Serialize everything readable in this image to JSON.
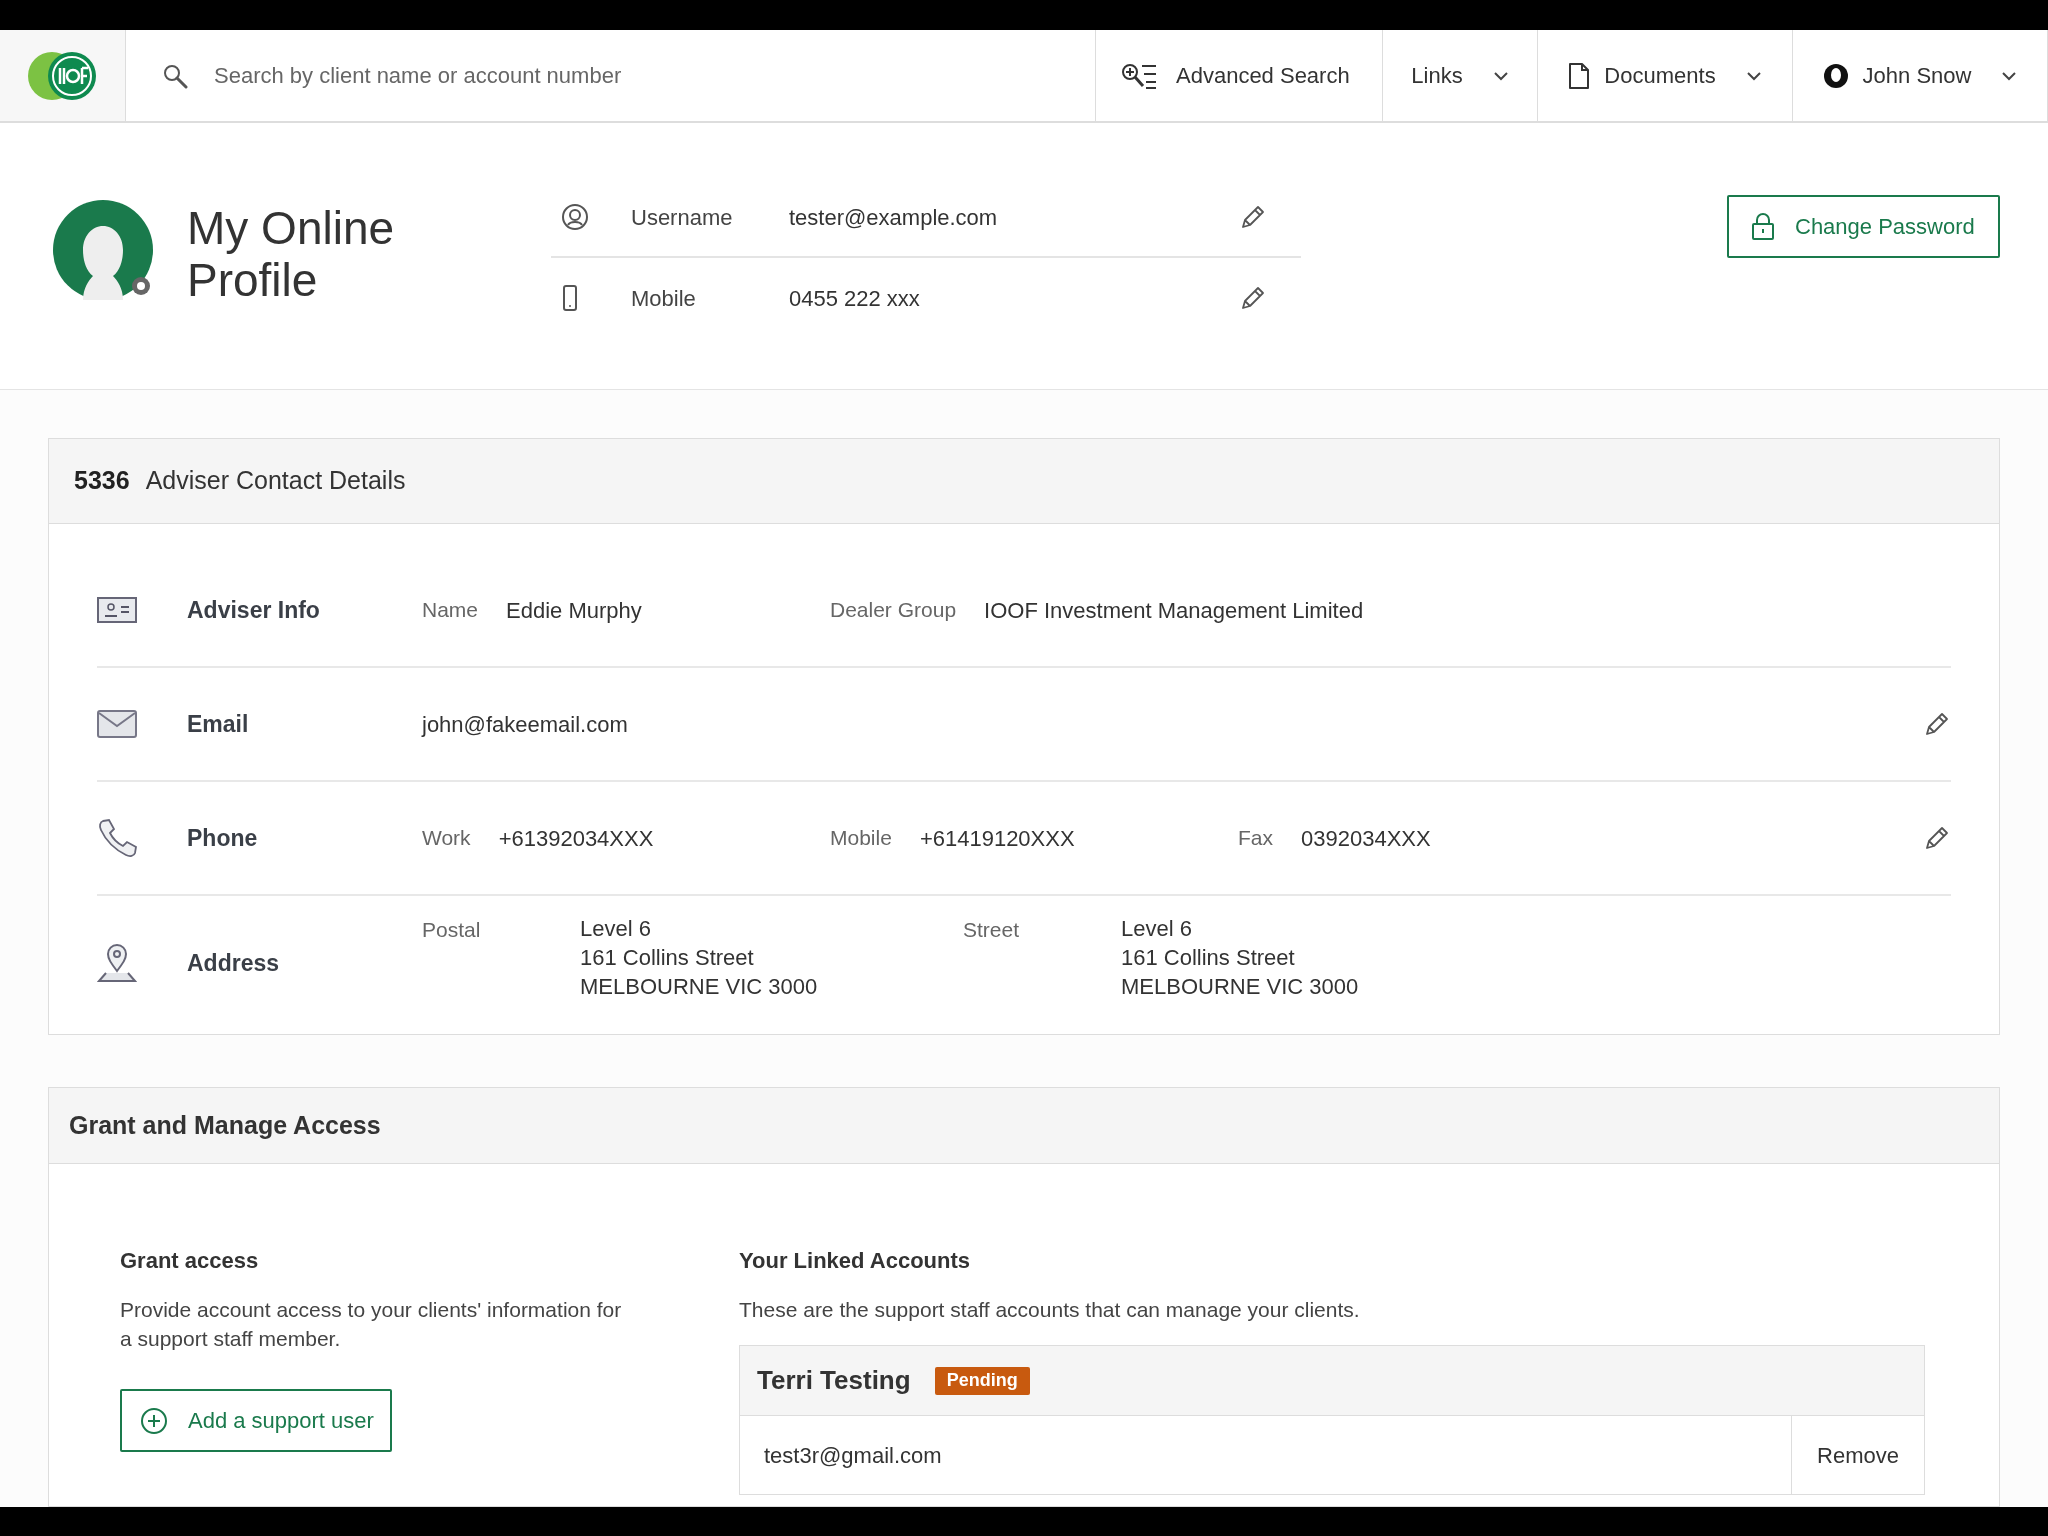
{
  "nav": {
    "search": {
      "placeholder": "Search by client name or account number"
    },
    "advanced_search": "Advanced Search",
    "menus": [
      {
        "kind": "links",
        "label": "Links"
      },
      {
        "kind": "documents",
        "label": "Documents"
      },
      {
        "kind": "user",
        "label": "John Snow"
      }
    ]
  },
  "profile": {
    "title": "My Online Profile",
    "fields": [
      {
        "kind": "username",
        "label": "Username",
        "value": "tester@example.com"
      },
      {
        "kind": "mobile",
        "label": "Mobile",
        "value": "0455 222 xxx"
      }
    ],
    "change_password": "Change Password"
  },
  "adviser_contact": {
    "number": "5336",
    "title": "Adviser Contact Details",
    "rows": [
      {
        "kind": "info",
        "label": "Adviser Info",
        "editable": false,
        "pairs": [
          {
            "label": "Name",
            "value": "Eddie Murphy"
          },
          {
            "label": "Dealer Group",
            "value": "IOOF Investment Management Limited"
          }
        ]
      },
      {
        "kind": "email",
        "label": "Email",
        "editable": true,
        "value": "john@fakeemail.com"
      },
      {
        "kind": "phone",
        "label": "Phone",
        "editable": true,
        "pairs": [
          {
            "label": "Work",
            "value": "+61392034XXX"
          },
          {
            "label": "Mobile",
            "value": "+61419120XXX"
          },
          {
            "label": "Fax",
            "value": "0392034XXX"
          }
        ]
      },
      {
        "kind": "address",
        "label": "Address",
        "editable": false,
        "addresses": [
          {
            "label": "Postal",
            "lines": [
              "Level 6",
              "161 Collins Street",
              "MELBOURNE VIC 3000"
            ]
          },
          {
            "label": "Street",
            "lines": [
              "Level 6",
              "161 Collins Street",
              "MELBOURNE VIC 3000"
            ]
          }
        ]
      }
    ]
  },
  "access": {
    "title": "Grant and Manage Access",
    "grant": {
      "heading": "Grant access",
      "text": "Provide account access to your clients' information for a support staff member.",
      "button": "Add a support user"
    },
    "linked": {
      "heading": "Your Linked Accounts",
      "text": "These are the support staff accounts that can manage your clients.",
      "accounts": [
        {
          "name": "Terri Testing",
          "status": "Pending",
          "email": "test3r@gmail.com",
          "action": "Remove"
        }
      ]
    }
  }
}
